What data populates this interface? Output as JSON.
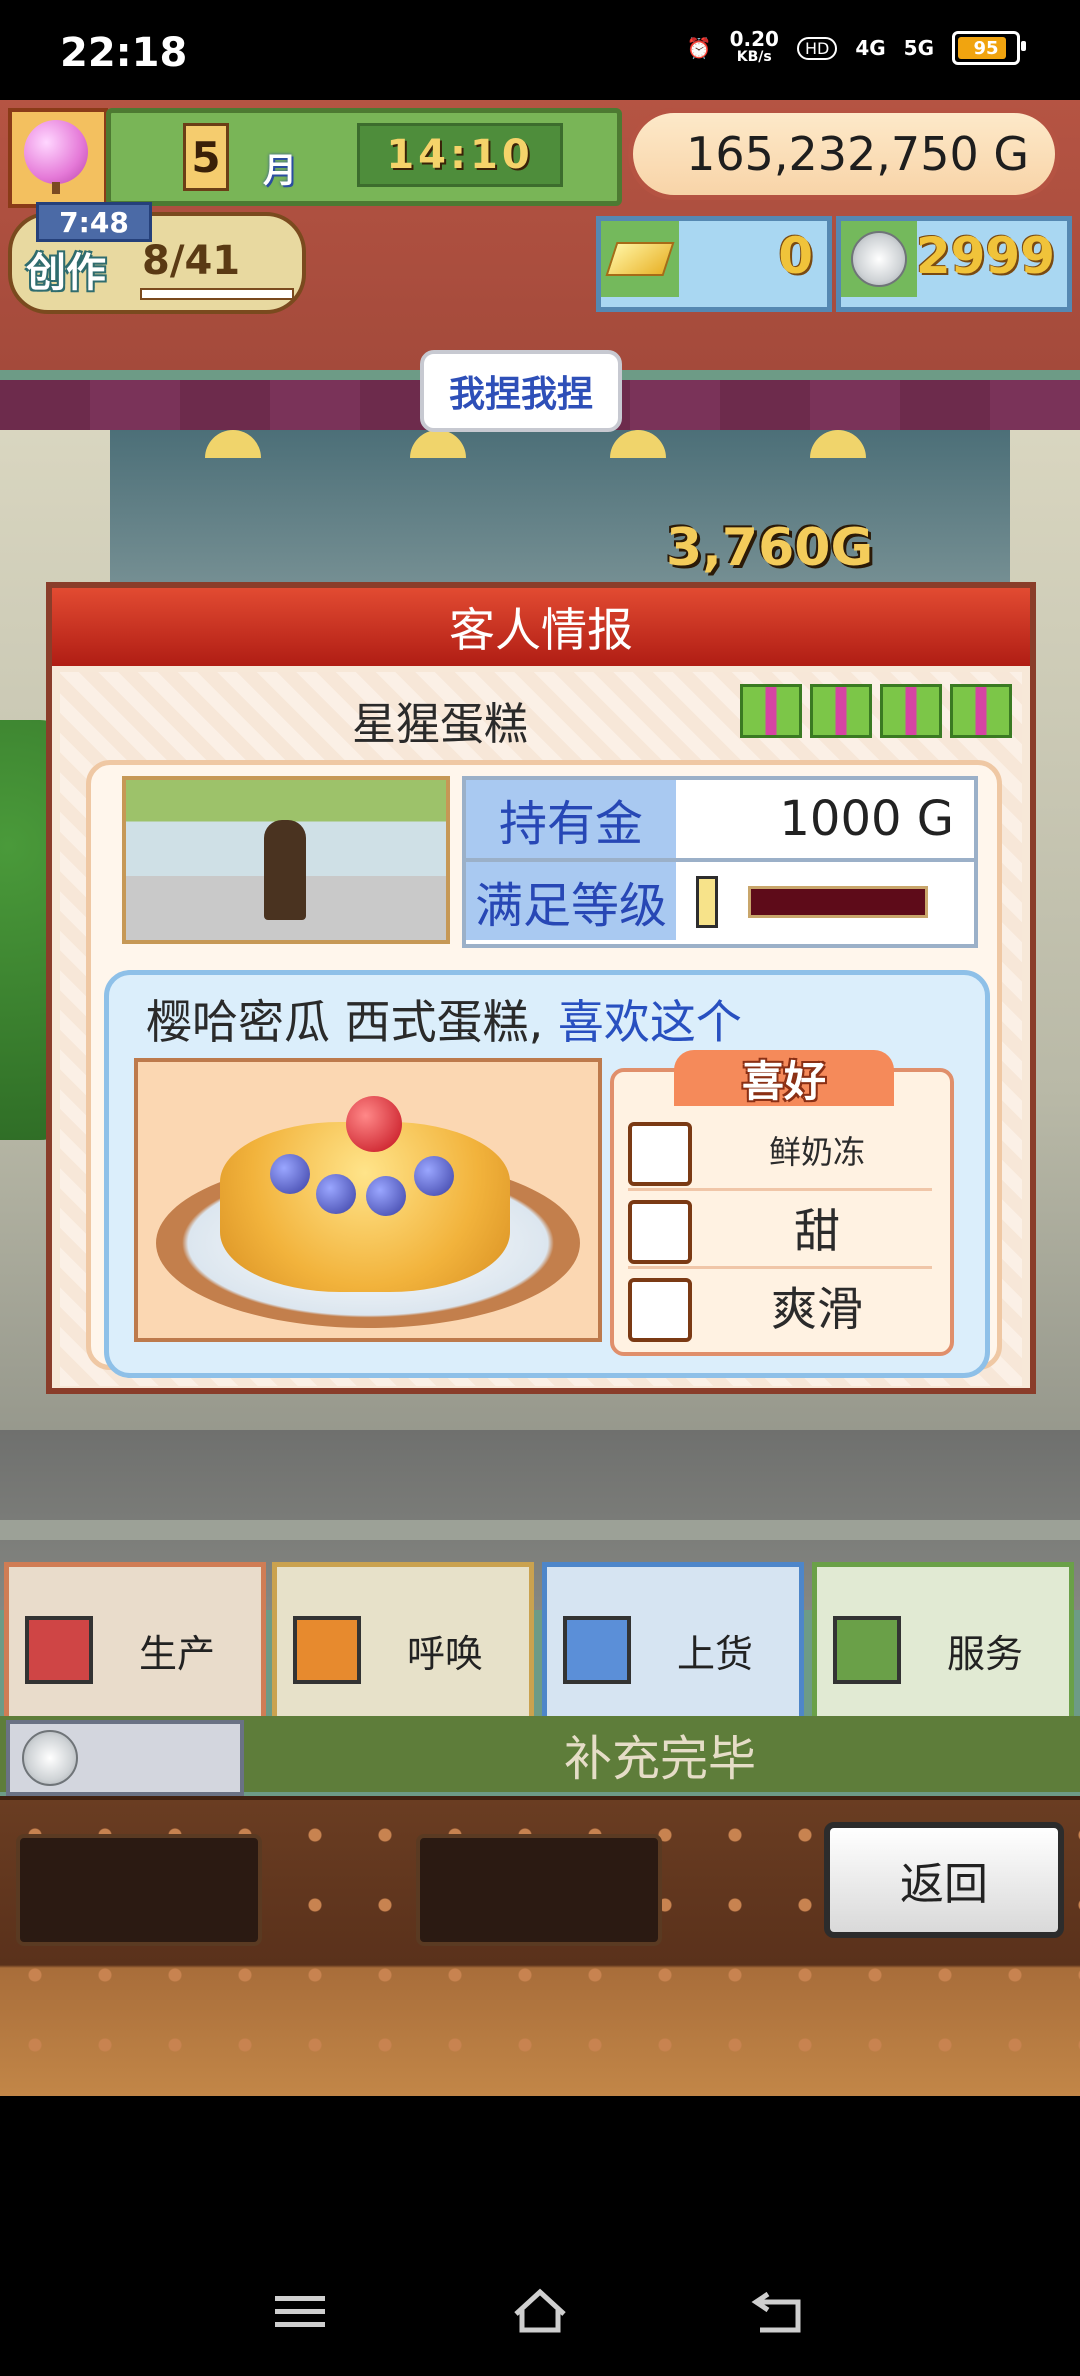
{
  "status_bar": {
    "time": "22:18",
    "net_speed": "0.20",
    "net_unit": "KB/s",
    "hd": "HD",
    "sig1": "4G",
    "sig2": "5G",
    "battery": "95"
  },
  "hud": {
    "month_number": "5",
    "month_label": "月",
    "clock": "14:10",
    "money": "165,232,750 G",
    "create_timer": "7:48",
    "create_label": "创作",
    "create_count": "8/41",
    "gold_bars": "0",
    "medals": "2999",
    "shop_sign": "我捏我捏",
    "floating_price": "3,760G"
  },
  "dialog": {
    "title": "客人情报",
    "customer_name": "星猩蛋糕",
    "stats": {
      "money_label": "持有金",
      "money_value": "1000 G",
      "satisfaction_label": "满足等级",
      "satisfaction_level": 0.08
    },
    "likes_text_main": "樱哈密瓜 西式蛋糕,",
    "likes_text_hl": "喜欢这个",
    "preferences_title": "喜好",
    "preferences": [
      {
        "label": "鲜奶冻",
        "icon": "pudding-icon"
      },
      {
        "label": "甜",
        "icon": "sweet-icon"
      },
      {
        "label": "爽滑",
        "icon": "smooth-icon"
      }
    ]
  },
  "menu": {
    "items": [
      {
        "label": "生产",
        "icon": "bread-icon",
        "bg": "#e9dccb",
        "border": "#d07d55"
      },
      {
        "label": "呼唤",
        "icon": "megaphone-icon",
        "bg": "#e7e1c9",
        "border": "#caa24f"
      },
      {
        "label": "上货",
        "icon": "cake-slice-icon",
        "bg": "#d6e4f2",
        "border": "#4e86c9"
      },
      {
        "label": "服务",
        "icon": "teacup-icon",
        "bg": "#e1ead3",
        "border": "#6aa048"
      }
    ],
    "refill_text": "补充完毕",
    "back_label": "返回"
  },
  "colors": {
    "accent_red": "#c72a1c",
    "accent_blue": "#2747b5"
  }
}
